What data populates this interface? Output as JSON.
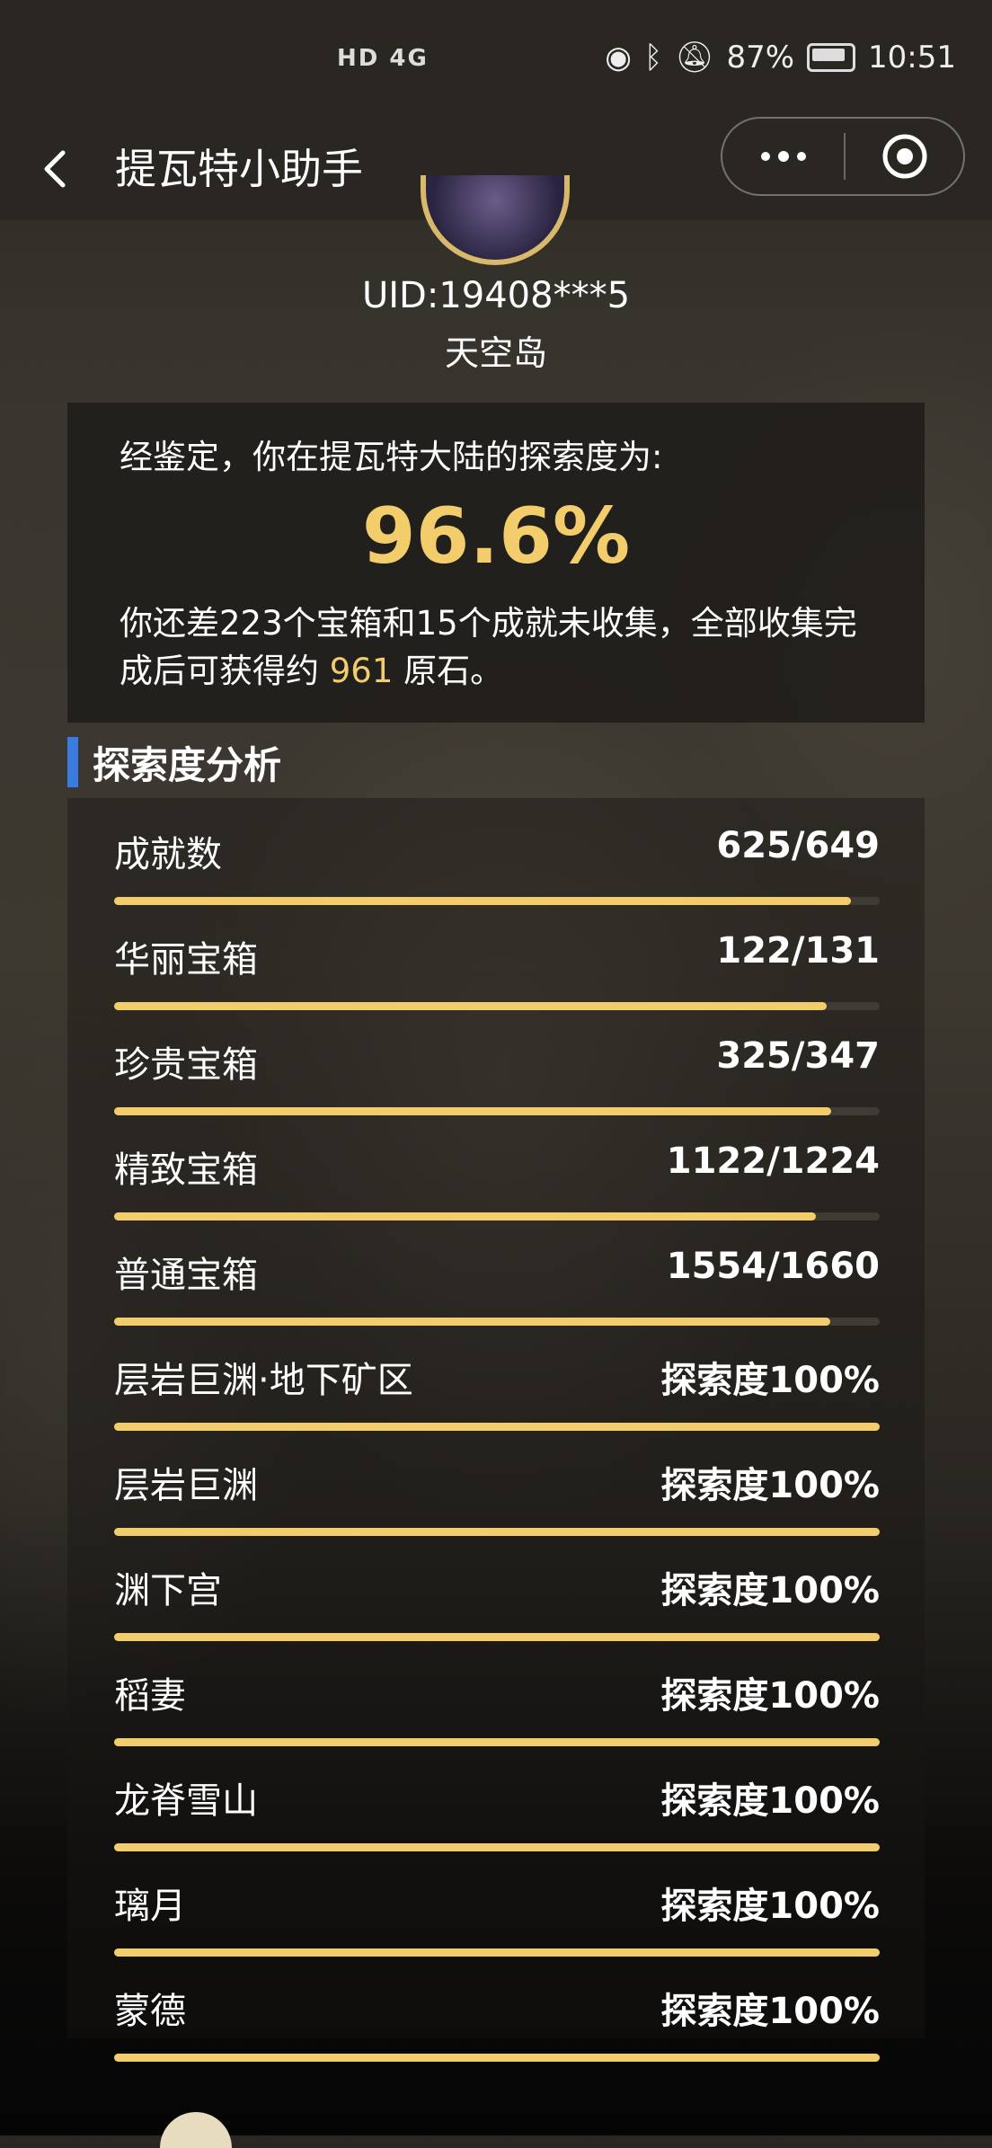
{
  "status_bar": {
    "network": "HD 4G",
    "battery": "87%",
    "time": "10:51"
  },
  "nav": {
    "title": "提瓦特小助手",
    "more_label": "•••"
  },
  "profile": {
    "uid": "UID:19408***5",
    "server": "天空岛"
  },
  "summary": {
    "intro": "经鉴定，你在提瓦特大陆的探索度为:",
    "percent": "96.6%",
    "remain_prefix": "你还差223个宝箱和15个成就未收集，全部收集完成后可获得约",
    "primogems": "961",
    "remain_suffix": "原石。"
  },
  "section": {
    "title": "探索度分析"
  },
  "stats": [
    {
      "label": "成就数",
      "value": "625/649",
      "progress": 0.963
    },
    {
      "label": "华丽宝箱",
      "value": "122/131",
      "progress": 0.931
    },
    {
      "label": "珍贵宝箱",
      "value": "325/347",
      "progress": 0.937
    },
    {
      "label": "精致宝箱",
      "value": "1122/1224",
      "progress": 0.917
    },
    {
      "label": "普通宝箱",
      "value": "1554/1660",
      "progress": 0.936
    },
    {
      "label": "层岩巨渊·地下矿区",
      "value": "探索度100%",
      "progress": 1.0
    },
    {
      "label": "层岩巨渊",
      "value": "探索度100%",
      "progress": 1.0
    },
    {
      "label": "渊下宫",
      "value": "探索度100%",
      "progress": 1.0
    },
    {
      "label": "稻妻",
      "value": "探索度100%",
      "progress": 1.0
    },
    {
      "label": "龙脊雪山",
      "value": "探索度100%",
      "progress": 1.0
    },
    {
      "label": "璃月",
      "value": "探索度100%",
      "progress": 1.0
    },
    {
      "label": "蒙德",
      "value": "探索度100%",
      "progress": 1.0
    }
  ],
  "colors": {
    "accent_gold": "#f3cd6b",
    "section_bar_blue": "#3a7be0"
  }
}
